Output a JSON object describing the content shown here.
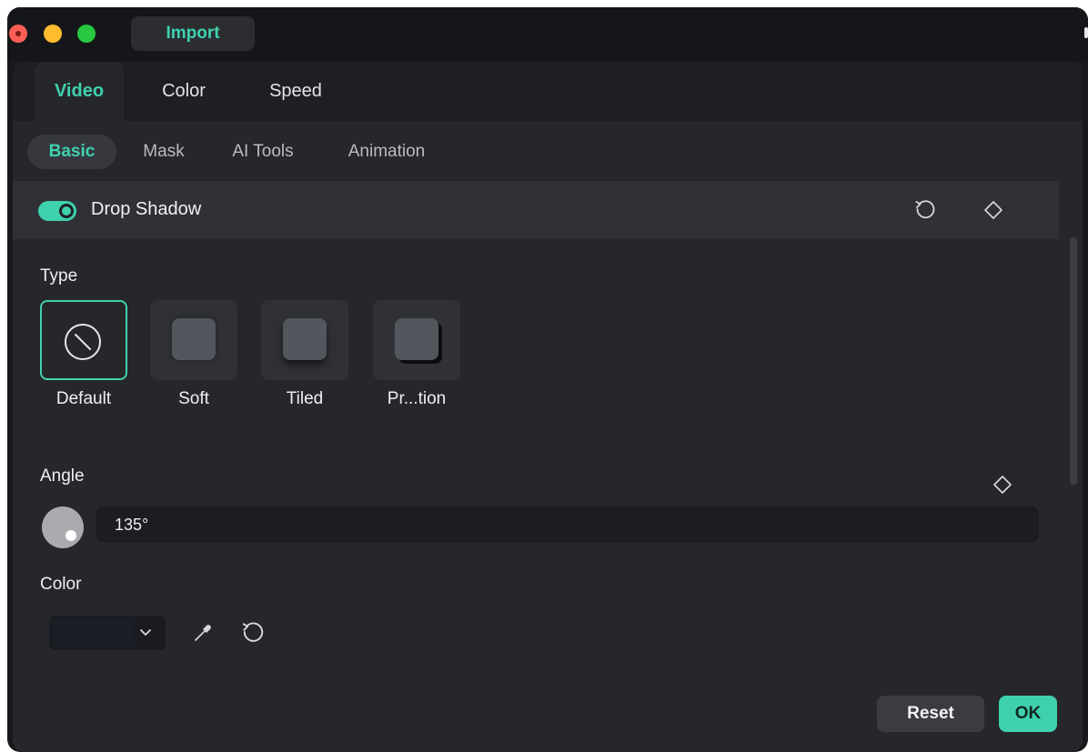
{
  "titlebar": {
    "import_label": "Import"
  },
  "tabs": [
    "Video",
    "Color",
    "Speed"
  ],
  "subtabs": [
    "Basic",
    "Mask",
    "AI Tools",
    "Animation"
  ],
  "section": {
    "title": "Drop Shadow",
    "enabled": true
  },
  "type": {
    "label": "Type",
    "options": [
      "Default",
      "Soft",
      "Tiled",
      "Pr...tion"
    ],
    "selected": "Default"
  },
  "angle": {
    "label": "Angle",
    "value": "135°"
  },
  "color": {
    "label": "Color",
    "value": "#1b1e27"
  },
  "footer": {
    "reset_label": "Reset",
    "ok_label": "OK"
  },
  "colors": {
    "accent": "#3fd1ae",
    "background": "#26272b"
  }
}
